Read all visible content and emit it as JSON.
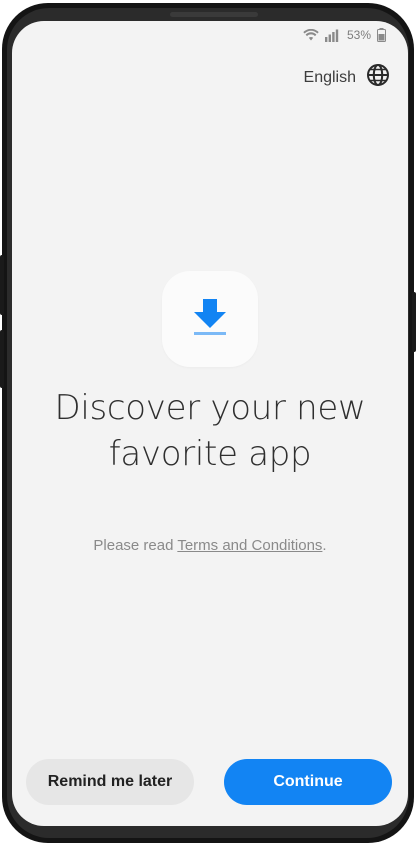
{
  "status_bar": {
    "battery_percent": "53%",
    "icons": [
      "wifi-icon",
      "signal-icon",
      "battery-icon"
    ]
  },
  "language": {
    "label": "English",
    "icon": "globe-icon"
  },
  "app_icon": {
    "icon": "download-icon",
    "accent_color": "#1284f3"
  },
  "headline": {
    "line1": "Discover your new",
    "line2": "favorite app"
  },
  "terms": {
    "prefix": "Please read ",
    "link_text": "Terms and Conditions",
    "suffix": "."
  },
  "buttons": {
    "remind_label": "Remind me later",
    "continue_label": "Continue",
    "continue_color": "#1284f3"
  }
}
